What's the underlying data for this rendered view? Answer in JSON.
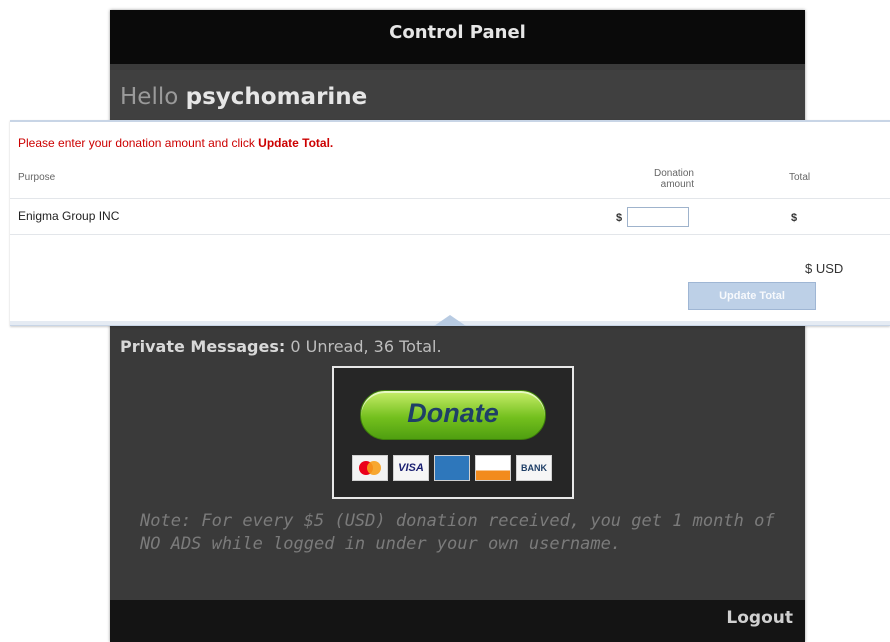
{
  "panel": {
    "title": "Control Panel",
    "greeting": "Hello",
    "username": "psychomarine",
    "private_messages_label": "Private Messages:",
    "private_messages_value": "0 Unread, 36 Total.",
    "donate_label": "Donate",
    "payment_cards": [
      "MasterCard",
      "VISA",
      "AMEX",
      "DISCOVER",
      "BANK"
    ],
    "note": "Note: For every $5 (USD) donation received, you get 1 month of NO ADS while logged in under your own username.",
    "logout_label": "Logout"
  },
  "donation_form": {
    "instruction_text": "Please enter your donation amount and click",
    "instruction_highlight": "Update Total.",
    "headers": {
      "purpose": "Purpose",
      "donation_amount_line1": "Donation",
      "donation_amount_line2": "amount",
      "total": "Total"
    },
    "rows": [
      {
        "purpose": "Enigma Group INC",
        "currency_symbol": "$",
        "amount": "",
        "total": "$"
      }
    ],
    "grand_total": "$ USD",
    "update_button_label": "Update Total"
  },
  "colors": {
    "panel_bg": "#3a3a3a",
    "header_bg": "#0a0a0a",
    "instruction_red": "#cc0000",
    "donate_green": "#74c01e",
    "update_button": "#bdd0e7"
  }
}
